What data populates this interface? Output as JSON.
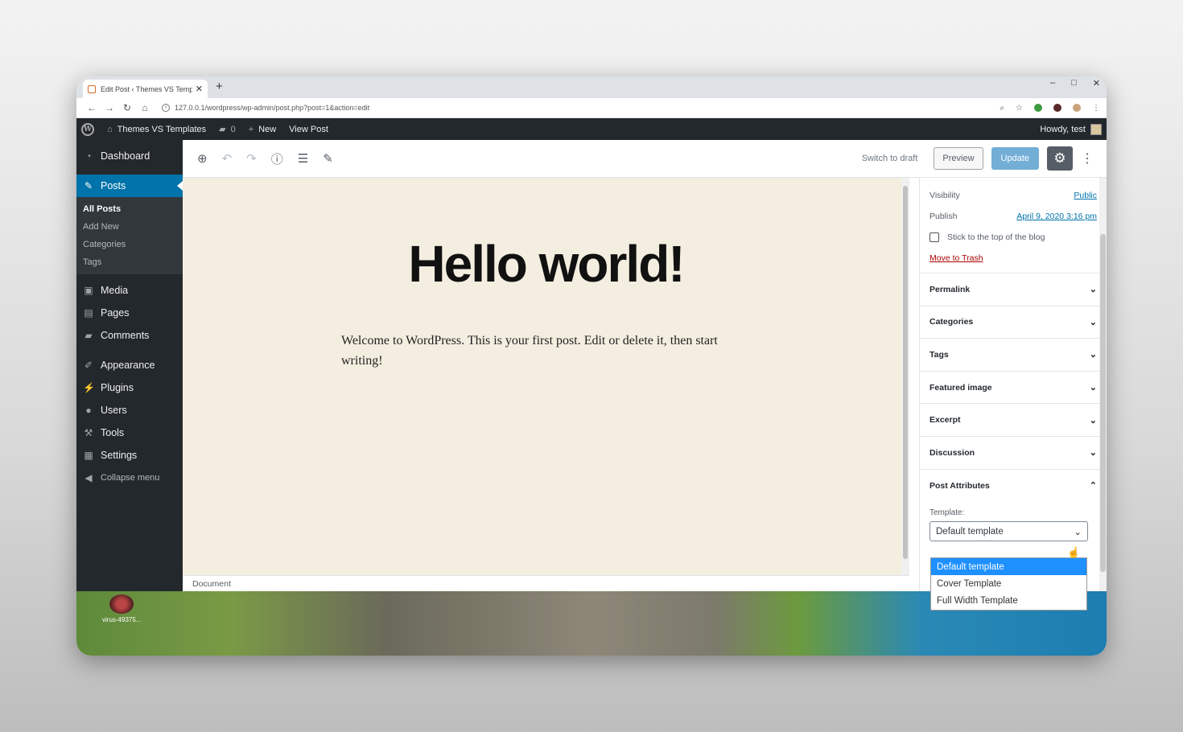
{
  "browser": {
    "tab_title": "Edit Post ‹ Themes VS Template:",
    "new_tab": "+",
    "url": "127.0.0.1/wordpress/wp-admin/post.php?post=1&action=edit",
    "win_min": "–",
    "win_max": "□",
    "win_close": "✕"
  },
  "adminbar": {
    "site_name": "Themes VS Templates",
    "comments_count": "0",
    "new_label": "New",
    "view_post": "View Post",
    "howdy": "Howdy, test"
  },
  "sidebar": {
    "dashboard": "Dashboard",
    "posts": "Posts",
    "submenu": [
      "All Posts",
      "Add New",
      "Categories",
      "Tags"
    ],
    "media": "Media",
    "pages": "Pages",
    "comments": "Comments",
    "appearance": "Appearance",
    "plugins": "Plugins",
    "users": "Users",
    "tools": "Tools",
    "settings": "Settings",
    "collapse": "Collapse menu"
  },
  "toolbar": {
    "switch_to_draft": "Switch to draft",
    "preview": "Preview",
    "update": "Update"
  },
  "post": {
    "title": "Hello world!",
    "content": "Welcome to WordPress. This is your first post. Edit or delete it, then start writing!"
  },
  "footer": {
    "breadcrumb": "Document"
  },
  "status": {
    "visibility_label": "Visibility",
    "visibility_value": "Public",
    "publish_label": "Publish",
    "publish_value": "April 9, 2020 3:16 pm",
    "sticky_label": "Stick to the top of the blog",
    "trash": "Move to Trash"
  },
  "panels": [
    "Permalink",
    "Categories",
    "Tags",
    "Featured image",
    "Excerpt",
    "Discussion"
  ],
  "post_attributes": {
    "title": "Post Attributes",
    "template_label": "Template:",
    "selected": "Default template",
    "options": [
      "Default template",
      "Cover Template",
      "Full Width Template"
    ]
  },
  "desktop": {
    "icon_label": "virus-49375..."
  },
  "colors": {
    "admin_dark": "#23282d",
    "accent_blue": "#0073aa",
    "canvas_bg": "#f4eee0",
    "dropdown_highlight": "#1e90ff"
  },
  "icons": [
    "wordpress-logo-icon",
    "home-icon",
    "comment-icon",
    "plus-icon",
    "add-block-icon",
    "undo-icon",
    "redo-icon",
    "info-icon",
    "list-view-icon",
    "edit-icon",
    "gear-icon",
    "kebab-icon",
    "chevron-down-icon",
    "chevron-up-icon"
  ]
}
